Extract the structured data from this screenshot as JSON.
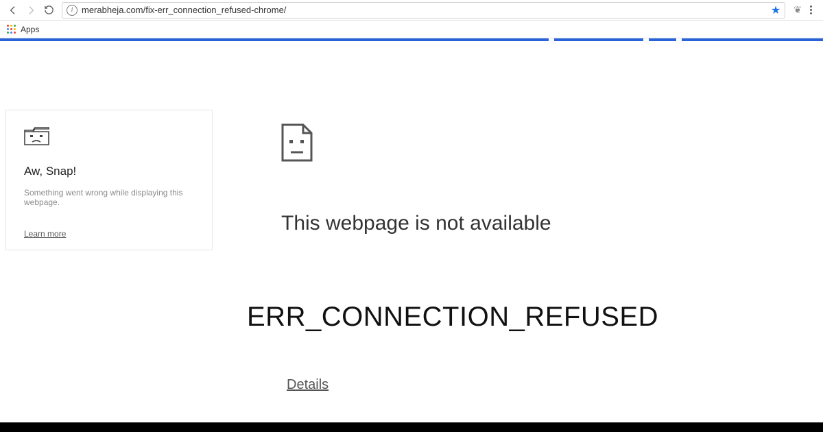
{
  "toolbar": {
    "url": "merabheja.com/fix-err_connection_refused-chrome/"
  },
  "bookmark_bar": {
    "apps_label": "Apps"
  },
  "snap_card": {
    "title": "Aw, Snap!",
    "subtitle": "Something went wrong while displaying this webpage.",
    "learn_more": "Learn more"
  },
  "main_error": {
    "heading": "This webpage is not available",
    "code": "ERR_CONNECTION_REFUSED",
    "details": "Details"
  }
}
